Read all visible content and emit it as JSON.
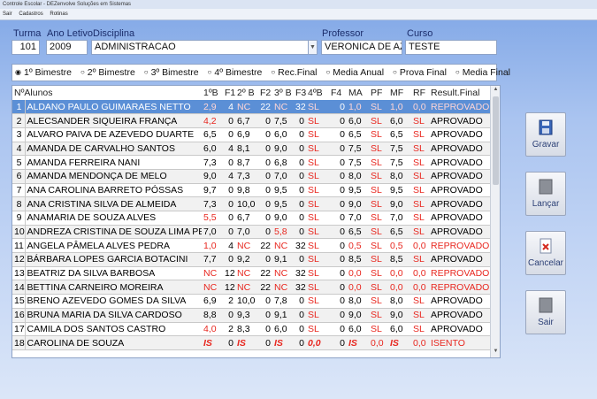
{
  "window": {
    "title": "Controle Escolar - DEZenvolve Soluções em Sistemas"
  },
  "menu": [
    "Sair",
    "Cadastros",
    "Rotinas"
  ],
  "header": {
    "turma": {
      "label": "Turma",
      "value": "101"
    },
    "ano_letivo": {
      "label": "Ano Letivo",
      "value": "2009"
    },
    "disciplina": {
      "label": "Disciplina",
      "value": "ADMINISTRACAO"
    },
    "professor": {
      "label": "Professor",
      "value": "VERONICA DE AZEVE"
    },
    "curso": {
      "label": "Curso",
      "value": "TESTE"
    }
  },
  "periods": [
    {
      "label": "1º Bimestre",
      "selected": true
    },
    {
      "label": "2º Bimestre",
      "selected": false
    },
    {
      "label": "3º Bimestre",
      "selected": false
    },
    {
      "label": "4º Bimestre",
      "selected": false
    },
    {
      "label": "Rec.Final",
      "selected": false
    },
    {
      "label": "Media Anual",
      "selected": false
    },
    {
      "label": "Prova Final",
      "selected": false
    },
    {
      "label": "Media Final",
      "selected": false
    }
  ],
  "grid": {
    "columns": [
      "NºAlunos",
      "1ºB",
      "F1",
      "2º B",
      "F2",
      "3º B",
      "F3",
      "4ºB",
      "F4",
      "MA",
      "PF",
      "MF",
      "RF",
      "Result.Final"
    ],
    "rows": [
      [
        "1",
        "ALDANO PAULO GUIMARAES NETTO",
        "2,9",
        "4",
        "NC",
        "22",
        "NC",
        "32",
        "SL",
        "0",
        "1,0",
        "SL",
        "1,0",
        "0,0",
        "REPROVADO"
      ],
      [
        "2",
        "ALECSANDER SIQUEIRA FRANÇA",
        "4,2",
        "0",
        "6,7",
        "0",
        "7,5",
        "0",
        "SL",
        "0",
        "6,0",
        "SL",
        "6,0",
        "SL",
        "APROVADO"
      ],
      [
        "3",
        "ALVARO PAIVA DE AZEVEDO DUARTE",
        "6,5",
        "0",
        "6,9",
        "0",
        "6,0",
        "0",
        "SL",
        "0",
        "6,5",
        "SL",
        "6,5",
        "SL",
        "APROVADO"
      ],
      [
        "4",
        "AMANDA DE CARVALHO SANTOS",
        "6,0",
        "4",
        "8,1",
        "0",
        "9,0",
        "0",
        "SL",
        "0",
        "7,5",
        "SL",
        "7,5",
        "SL",
        "APROVADO"
      ],
      [
        "5",
        "AMANDA FERREIRA NANI",
        "7,3",
        "0",
        "8,7",
        "0",
        "6,8",
        "0",
        "SL",
        "0",
        "7,5",
        "SL",
        "7,5",
        "SL",
        "APROVADO"
      ],
      [
        "6",
        "AMANDA MENDONÇA DE MELO",
        "9,0",
        "4",
        "7,3",
        "0",
        "7,0",
        "0",
        "SL",
        "0",
        "8,0",
        "SL",
        "8,0",
        "SL",
        "APROVADO"
      ],
      [
        "7",
        "ANA CAROLINA BARRETO PÓSSAS",
        "9,7",
        "0",
        "9,8",
        "0",
        "9,5",
        "0",
        "SL",
        "0",
        "9,5",
        "SL",
        "9,5",
        "SL",
        "APROVADO"
      ],
      [
        "8",
        "ANA CRISTINA SILVA DE ALMEIDA",
        "7,3",
        "0",
        "10,0",
        "0",
        "9,5",
        "0",
        "SL",
        "0",
        "9,0",
        "SL",
        "9,0",
        "SL",
        "APROVADO"
      ],
      [
        "9",
        "ANAMARIA DE SOUZA ALVES",
        "5,5",
        "0",
        "6,7",
        "0",
        "9,0",
        "0",
        "SL",
        "0",
        "7,0",
        "SL",
        "7,0",
        "SL",
        "APROVADO"
      ],
      [
        "10",
        "ANDREZA CRISTINA DE SOUZA LIMA PEREIRA",
        "7,0",
        "0",
        "7,0",
        "0",
        "5,8",
        "0",
        "SL",
        "0",
        "6,5",
        "SL",
        "6,5",
        "SL",
        "APROVADO"
      ],
      [
        "11",
        "ANGELA PÂMELA ALVES PEDRA",
        "1,0",
        "4",
        "NC",
        "22",
        "NC",
        "32",
        "SL",
        "0",
        "0,5",
        "SL",
        "0,5",
        "0,0",
        "REPROVADO"
      ],
      [
        "12",
        "BÁRBARA LOPES GARCIA BOTACINI",
        "7,7",
        "0",
        "9,2",
        "0",
        "9,1",
        "0",
        "SL",
        "0",
        "8,5",
        "SL",
        "8,5",
        "SL",
        "APROVADO"
      ],
      [
        "13",
        "BEATRIZ DA SILVA BARBOSA",
        "NC",
        "12",
        "NC",
        "22",
        "NC",
        "32",
        "SL",
        "0",
        "0,0",
        "SL",
        "0,0",
        "0,0",
        "REPROVADO"
      ],
      [
        "14",
        "BETTINA CARNEIRO MOREIRA",
        "NC",
        "12",
        "NC",
        "22",
        "NC",
        "32",
        "SL",
        "0",
        "0,0",
        "SL",
        "0,0",
        "0,0",
        "REPROVADO"
      ],
      [
        "15",
        "BRENO AZEVEDO GOMES DA SILVA",
        "6,9",
        "2",
        "10,0",
        "0",
        "7,8",
        "0",
        "SL",
        "0",
        "8,0",
        "SL",
        "8,0",
        "SL",
        "APROVADO"
      ],
      [
        "16",
        "BRUNA MARIA DA SILVA CARDOSO",
        "8,8",
        "0",
        "9,3",
        "0",
        "9,1",
        "0",
        "SL",
        "0",
        "9,0",
        "SL",
        "9,0",
        "SL",
        "APROVADO"
      ],
      [
        "17",
        "CAMILA DOS SANTOS CASTRO",
        "4,0",
        "2",
        "8,3",
        "0",
        "6,0",
        "0",
        "SL",
        "0",
        "6,0",
        "SL",
        "6,0",
        "SL",
        "APROVADO"
      ],
      [
        "18",
        "CAROLINA DE SOUZA",
        "IS",
        "0",
        "IS",
        "0",
        "IS",
        "0",
        "0,0",
        "0",
        "IS",
        "0,0",
        "IS",
        "0,0",
        "ISENTO"
      ]
    ]
  },
  "buttons": {
    "gravar": "Gravar",
    "lancar": "Lançar",
    "cancelar": "Cancelar",
    "sair": "Sair"
  }
}
